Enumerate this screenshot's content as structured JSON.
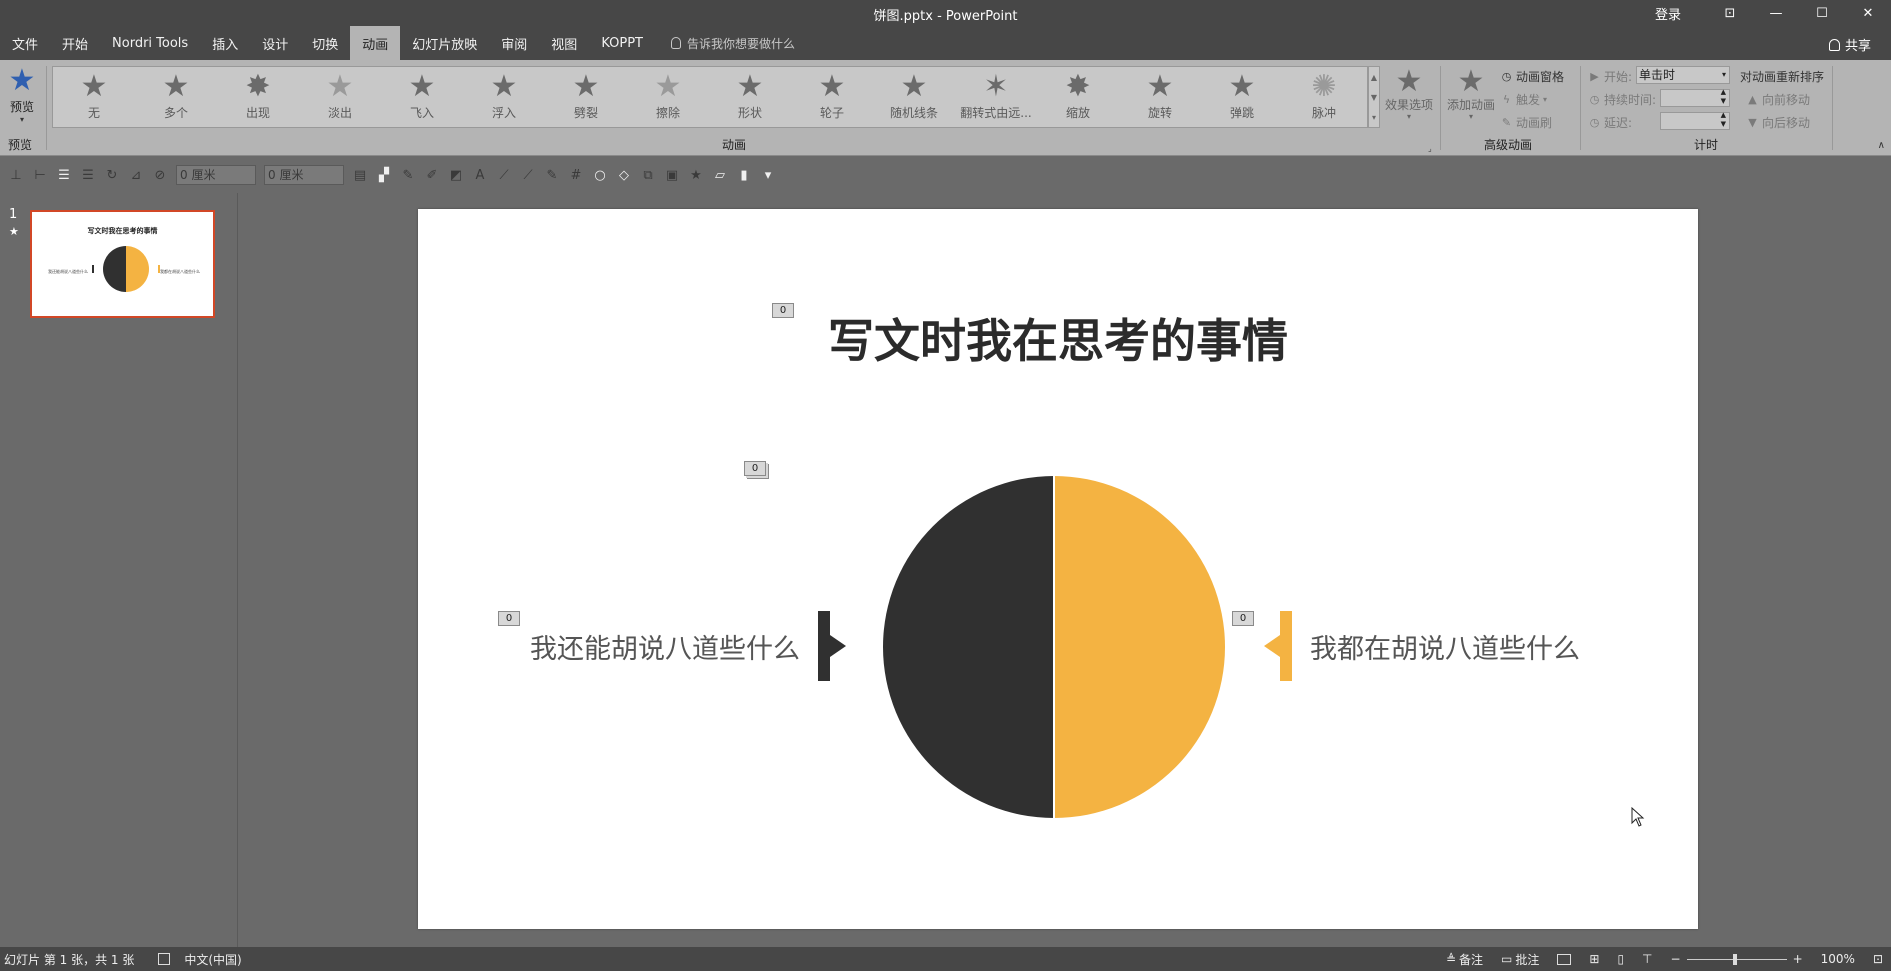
{
  "window": {
    "title": "饼图.pptx - PowerPoint",
    "login": "登录",
    "controls": {
      "ribbon_display": "⊡",
      "minimize": "—",
      "maximize": "☐",
      "close": "✕"
    }
  },
  "tabs": [
    {
      "label": "文件",
      "active": false
    },
    {
      "label": "开始",
      "active": false
    },
    {
      "label": "Nordri Tools",
      "active": false
    },
    {
      "label": "插入",
      "active": false
    },
    {
      "label": "设计",
      "active": false
    },
    {
      "label": "切换",
      "active": false
    },
    {
      "label": "动画",
      "active": true
    },
    {
      "label": "幻灯片放映",
      "active": false
    },
    {
      "label": "审阅",
      "active": false
    },
    {
      "label": "视图",
      "active": false
    },
    {
      "label": "KOPPT",
      "active": false
    }
  ],
  "tellme": {
    "placeholder": "告诉我你想要做什么"
  },
  "share": {
    "label": "共享"
  },
  "ribbon": {
    "preview": {
      "label": "预览",
      "group": "预览"
    },
    "animations": [
      {
        "name": "无",
        "icon": "★",
        "dim": false
      },
      {
        "name": "多个",
        "icon": "★",
        "dim": false
      },
      {
        "name": "出现",
        "icon": "✸",
        "dim": false
      },
      {
        "name": "淡出",
        "icon": "★",
        "dim": true
      },
      {
        "name": "飞入",
        "icon": "★",
        "dim": false
      },
      {
        "name": "浮入",
        "icon": "★",
        "dim": false
      },
      {
        "name": "劈裂",
        "icon": "★",
        "dim": false
      },
      {
        "name": "擦除",
        "icon": "★",
        "dim": true
      },
      {
        "name": "形状",
        "icon": "★",
        "dim": false
      },
      {
        "name": "轮子",
        "icon": "★",
        "dim": false
      },
      {
        "name": "随机线条",
        "icon": "★",
        "dim": false
      },
      {
        "name": "翻转式由远...",
        "icon": "✶",
        "dim": false
      },
      {
        "name": "缩放",
        "icon": "✸",
        "dim": false
      },
      {
        "name": "旋转",
        "icon": "★",
        "dim": false
      },
      {
        "name": "弹跳",
        "icon": "★",
        "dim": false
      },
      {
        "name": "脉冲",
        "icon": "✺",
        "dim": true
      }
    ],
    "animation_group": "动画",
    "effect_options": "效果选项",
    "add_animation": "添加动画",
    "animation_pane": "动画窗格",
    "trigger": "触发",
    "animation_painter": "动画刷",
    "advanced_group": "高级动画",
    "start_label": "开始:",
    "start_value": "单击时",
    "duration_label": "持续时间:",
    "delay_label": "延迟:",
    "timing_group": "计时",
    "reorder_title": "对动画重新排序",
    "move_earlier": "向前移动",
    "move_later": "向后移动"
  },
  "drawtoolbar": {
    "width_value": "0 厘米",
    "height_value": "0 厘米"
  },
  "slides_panel": {
    "number": "1",
    "star": "★",
    "thumb_title": "写文时我在思考的事情",
    "thumb_left": "我还能胡说八道些什么",
    "thumb_right": "我都在胡说八道些什么"
  },
  "slide": {
    "title": "写文时我在思考的事情",
    "left_text": "我还能胡说八道些什么",
    "right_text": "我都在胡说八道些什么",
    "tags": {
      "title": "0",
      "chart": "0",
      "left": "0",
      "right": "0"
    },
    "colors": {
      "dark": "#303030",
      "accent": "#f4b342"
    }
  },
  "statusbar": {
    "slide_info": "幻灯片 第 1 张，共 1 张",
    "language": "中文(中国)",
    "notes": "备注",
    "comments": "批注",
    "zoom": "100%"
  }
}
